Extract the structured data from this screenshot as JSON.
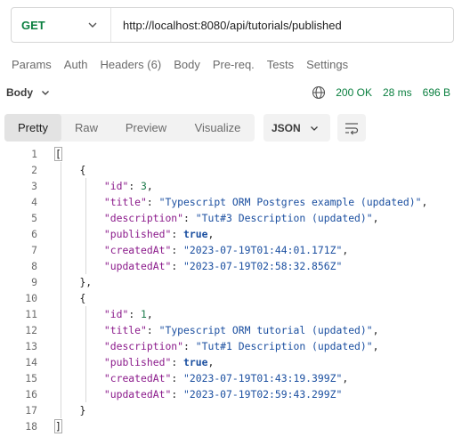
{
  "request": {
    "method": "GET",
    "url": "http://localhost:8080/api/tutorials/published"
  },
  "tabs": [
    "Params",
    "Auth",
    "Headers (6)",
    "Body",
    "Pre-req.",
    "Tests",
    "Settings"
  ],
  "response": {
    "section_label": "Body",
    "status": "200 OK",
    "time": "28 ms",
    "size": "696 B"
  },
  "view_options": [
    "Pretty",
    "Raw",
    "Preview",
    "Visualize"
  ],
  "active_view": "Pretty",
  "format": "JSON",
  "colors": {
    "method": "#0a7f3f",
    "status": "#0a7f3f",
    "json_key": "#8b1a8b",
    "json_string": "#1b4fa0",
    "json_number": "#1b7a4a"
  },
  "code_lines": [
    {
      "n": "1",
      "indent": 0,
      "parts": [
        {
          "t": "[",
          "c": "bracket"
        }
      ]
    },
    {
      "n": "2",
      "indent": 1,
      "parts": [
        {
          "t": "{",
          "c": "punc"
        }
      ]
    },
    {
      "n": "3",
      "indent": 2,
      "parts": [
        {
          "t": "\"id\"",
          "c": "key"
        },
        {
          "t": ": ",
          "c": "punc"
        },
        {
          "t": "3",
          "c": "num"
        },
        {
          "t": ",",
          "c": "punc"
        }
      ]
    },
    {
      "n": "4",
      "indent": 2,
      "parts": [
        {
          "t": "\"title\"",
          "c": "key"
        },
        {
          "t": ": ",
          "c": "punc"
        },
        {
          "t": "\"Typescript ORM Postgres example (updated)\"",
          "c": "str"
        },
        {
          "t": ",",
          "c": "punc"
        }
      ]
    },
    {
      "n": "5",
      "indent": 2,
      "parts": [
        {
          "t": "\"description\"",
          "c": "key"
        },
        {
          "t": ": ",
          "c": "punc"
        },
        {
          "t": "\"Tut#3 Description (updated)\"",
          "c": "str"
        },
        {
          "t": ",",
          "c": "punc"
        }
      ]
    },
    {
      "n": "6",
      "indent": 2,
      "parts": [
        {
          "t": "\"published\"",
          "c": "key"
        },
        {
          "t": ": ",
          "c": "punc"
        },
        {
          "t": "true",
          "c": "bool"
        },
        {
          "t": ",",
          "c": "punc"
        }
      ]
    },
    {
      "n": "7",
      "indent": 2,
      "parts": [
        {
          "t": "\"createdAt\"",
          "c": "key"
        },
        {
          "t": ": ",
          "c": "punc"
        },
        {
          "t": "\"2023-07-19T01:44:01.171Z\"",
          "c": "str"
        },
        {
          "t": ",",
          "c": "punc"
        }
      ]
    },
    {
      "n": "8",
      "indent": 2,
      "parts": [
        {
          "t": "\"updatedAt\"",
          "c": "key"
        },
        {
          "t": ": ",
          "c": "punc"
        },
        {
          "t": "\"2023-07-19T02:58:32.856Z\"",
          "c": "str"
        }
      ]
    },
    {
      "n": "9",
      "indent": 1,
      "parts": [
        {
          "t": "},",
          "c": "punc"
        }
      ]
    },
    {
      "n": "10",
      "indent": 1,
      "parts": [
        {
          "t": "{",
          "c": "punc"
        }
      ]
    },
    {
      "n": "11",
      "indent": 2,
      "parts": [
        {
          "t": "\"id\"",
          "c": "key"
        },
        {
          "t": ": ",
          "c": "punc"
        },
        {
          "t": "1",
          "c": "num"
        },
        {
          "t": ",",
          "c": "punc"
        }
      ]
    },
    {
      "n": "12",
      "indent": 2,
      "parts": [
        {
          "t": "\"title\"",
          "c": "key"
        },
        {
          "t": ": ",
          "c": "punc"
        },
        {
          "t": "\"Typescript ORM tutorial (updated)\"",
          "c": "str"
        },
        {
          "t": ",",
          "c": "punc"
        }
      ]
    },
    {
      "n": "13",
      "indent": 2,
      "parts": [
        {
          "t": "\"description\"",
          "c": "key"
        },
        {
          "t": ": ",
          "c": "punc"
        },
        {
          "t": "\"Tut#1 Description (updated)\"",
          "c": "str"
        },
        {
          "t": ",",
          "c": "punc"
        }
      ]
    },
    {
      "n": "14",
      "indent": 2,
      "parts": [
        {
          "t": "\"published\"",
          "c": "key"
        },
        {
          "t": ": ",
          "c": "punc"
        },
        {
          "t": "true",
          "c": "bool"
        },
        {
          "t": ",",
          "c": "punc"
        }
      ]
    },
    {
      "n": "15",
      "indent": 2,
      "parts": [
        {
          "t": "\"createdAt\"",
          "c": "key"
        },
        {
          "t": ": ",
          "c": "punc"
        },
        {
          "t": "\"2023-07-19T01:43:19.399Z\"",
          "c": "str"
        },
        {
          "t": ",",
          "c": "punc"
        }
      ]
    },
    {
      "n": "16",
      "indent": 2,
      "parts": [
        {
          "t": "\"updatedAt\"",
          "c": "key"
        },
        {
          "t": ": ",
          "c": "punc"
        },
        {
          "t": "\"2023-07-19T02:59:43.299Z\"",
          "c": "str"
        }
      ]
    },
    {
      "n": "17",
      "indent": 1,
      "parts": [
        {
          "t": "}",
          "c": "punc"
        }
      ]
    },
    {
      "n": "18",
      "indent": 0,
      "parts": [
        {
          "t": "]",
          "c": "bracket"
        }
      ]
    }
  ]
}
